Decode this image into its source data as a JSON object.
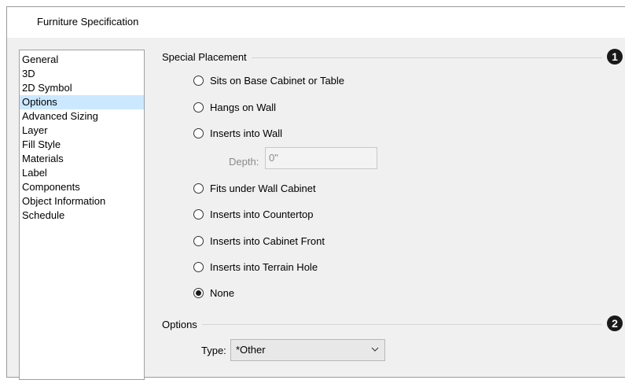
{
  "window": {
    "title": "Furniture Specification"
  },
  "sidebar": {
    "items": [
      {
        "label": "General"
      },
      {
        "label": "3D"
      },
      {
        "label": "2D Symbol"
      },
      {
        "label": "Options",
        "selected": true
      },
      {
        "label": "Advanced Sizing"
      },
      {
        "label": "Layer"
      },
      {
        "label": "Fill Style"
      },
      {
        "label": "Materials"
      },
      {
        "label": "Label"
      },
      {
        "label": "Components"
      },
      {
        "label": "Object Information"
      },
      {
        "label": "Schedule"
      }
    ]
  },
  "special_placement": {
    "heading": "Special Placement",
    "callout": "1",
    "options": [
      {
        "label": "Sits on Base Cabinet or Table",
        "checked": false
      },
      {
        "label": "Hangs on Wall",
        "checked": false
      },
      {
        "label": "Inserts into Wall",
        "checked": false
      },
      {
        "label": "Fits under Wall Cabinet",
        "checked": false
      },
      {
        "label": "Inserts into Countertop",
        "checked": false
      },
      {
        "label": "Inserts into Cabinet Front",
        "checked": false
      },
      {
        "label": "Inserts into Terrain Hole",
        "checked": false
      },
      {
        "label": "None",
        "checked": true
      }
    ],
    "depth": {
      "label": "Depth:",
      "value": "0\""
    }
  },
  "options_group": {
    "heading": "Options",
    "callout": "2",
    "type": {
      "label": "Type:",
      "value": "*Other",
      "icon": "chevron-down-icon"
    }
  },
  "colors": {
    "dialog_bg": "#f0f0f0",
    "selected_item": "#cce8ff",
    "callout_bg": "#1a1a1a"
  }
}
